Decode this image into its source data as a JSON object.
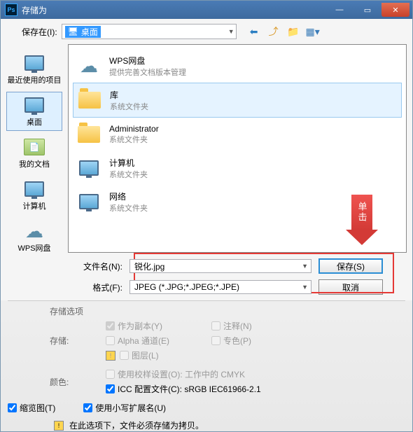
{
  "titlebar": {
    "title": "存储为"
  },
  "toolbar": {
    "save_in_label": "保存在(I):",
    "location": "桌面"
  },
  "sidebar": {
    "items": [
      {
        "label": "最近使用的项目"
      },
      {
        "label": "桌面"
      },
      {
        "label": "我的文档"
      },
      {
        "label": "计算机"
      },
      {
        "label": "WPS网盘"
      }
    ]
  },
  "filelist": [
    {
      "name": "WPS网盘",
      "sub": "提供完善文档版本管理"
    },
    {
      "name": "库",
      "sub": "系统文件夹"
    },
    {
      "name": "Administrator",
      "sub": "系统文件夹"
    },
    {
      "name": "计算机",
      "sub": "系统文件夹"
    },
    {
      "name": "网络",
      "sub": "系统文件夹"
    }
  ],
  "fields": {
    "filename_label": "文件名(N):",
    "filename_value": "锐化.jpg",
    "format_label": "格式(F):",
    "format_value": "JPEG (*.JPG;*.JPEG;*.JPE)",
    "save_btn": "保存(S)",
    "cancel_btn": "取消"
  },
  "options": {
    "section_label": "存储选项",
    "store_label": "存储:",
    "as_copy": "作为副本(Y)",
    "notes": "注释(N)",
    "alpha": "Alpha 通道(E)",
    "spot": "专色(P)",
    "layers": "图层(L)",
    "color_label": "颜色:",
    "proof": "使用校样设置(O):  工作中的 CMYK",
    "icc": "ICC 配置文件(C):  sRGB IEC61966-2.1",
    "thumb": "缩览图(T)",
    "lowercase": "使用小写扩展名(U)",
    "note": "在此选项下，文件必须存储为拷贝。"
  },
  "callout": {
    "text": "单击"
  }
}
